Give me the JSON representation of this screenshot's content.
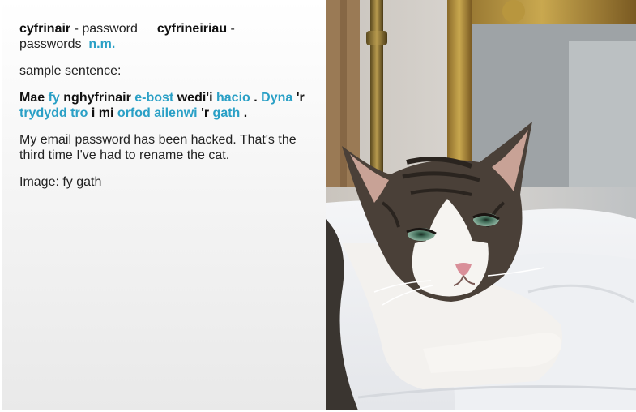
{
  "vocab": {
    "word1": "cyfrinair",
    "sep1": " - password",
    "word2": "cyfrineiriau",
    "sep2": " - passwords",
    "gender": "n.m."
  },
  "sample_label": "sample sentence:",
  "sentence": {
    "t1": "Mae",
    "t2": "fy",
    "t3": "nghyfrinair",
    "t4": "e-bost",
    "t5": "wedi'i",
    "t6": "hacio",
    "t7": ".",
    "t8": "Dyna",
    "t9": "'r",
    "t10": "trydydd tro",
    "t11": "i mi",
    "t12": "orfod",
    "t13": "ailenwi",
    "t14": "'r",
    "t15": "gath",
    "t16": "."
  },
  "translation": "My email password has been hacked. That's the third time I've had to rename the cat.",
  "image_caption": "Image: fy gath",
  "colors": {
    "link": "#2aa0c6",
    "text": "#222222"
  }
}
